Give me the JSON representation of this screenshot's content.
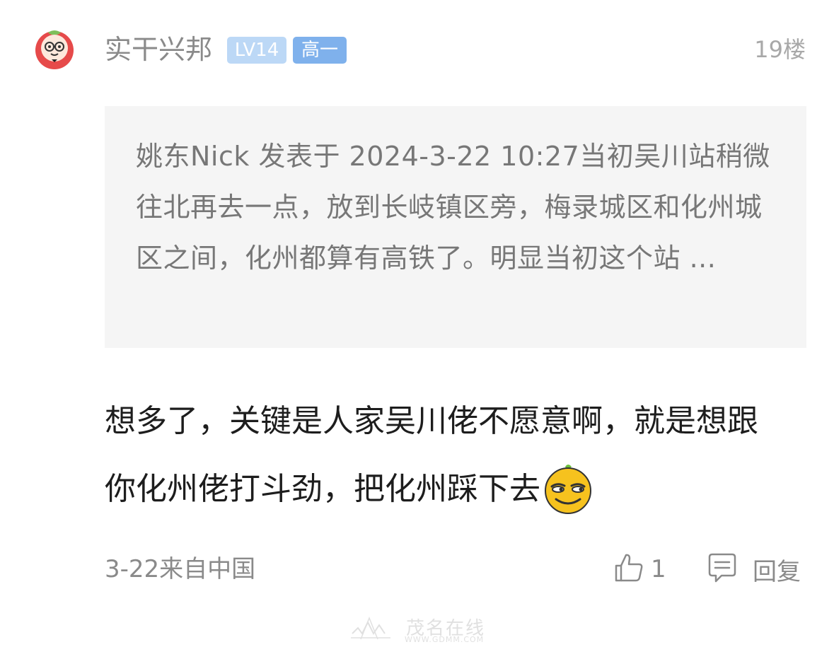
{
  "post": {
    "username": "实干兴邦",
    "level_badge": "LV14",
    "grade_badge": "高一",
    "floor": "19楼",
    "quote": "姚东Nick 发表于 2024-3-22 10:27当初吴川站稍微往北再去一点，放到长岐镇区旁，梅录城区和化州城区之间，化州都算有高铁了。明显当初这个站 ...",
    "reply": "想多了，关键是人家吴川佬不愿意啊，就是想跟你化州佬打斗劲，把化州踩下去",
    "emoji": "smug-smiley-icon",
    "date_location": "3-22来自中国",
    "like_count": "1",
    "reply_label": "回复"
  },
  "watermark": {
    "main": "茂名在线",
    "sub": "WWW.GDMM.COM"
  },
  "colors": {
    "badge_level": "#bcd8f6",
    "badge_grade": "#7fb1ec",
    "quote_bg": "#f5f5f5",
    "muted_text": "#8a8a8a"
  }
}
